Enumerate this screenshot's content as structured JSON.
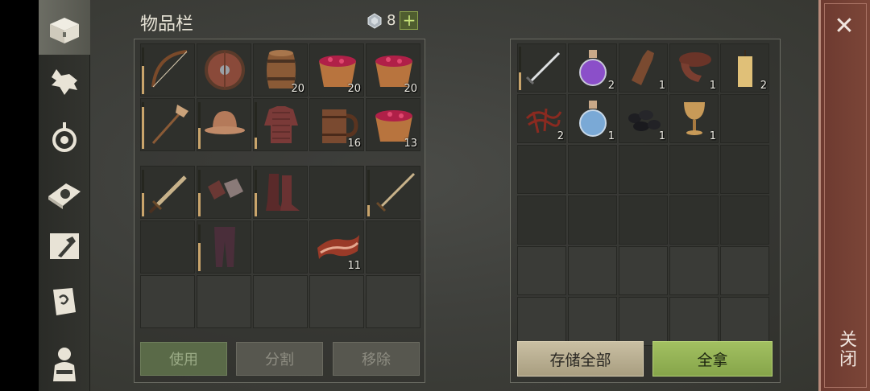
{
  "inventory": {
    "title": "物品栏",
    "currency": {
      "icon": "gem-icon",
      "count": "8",
      "add_label": "+"
    },
    "top_grid": [
      {
        "name": "bow",
        "icon": "bow-icon",
        "qty": "",
        "durability": 0.6
      },
      {
        "name": "round-shield",
        "icon": "shield-icon",
        "qty": ""
      },
      {
        "name": "barrel",
        "icon": "barrel-icon",
        "qty": "20"
      },
      {
        "name": "berry-bowl",
        "icon": "berry-bowl-icon",
        "qty": "20"
      },
      {
        "name": "berry-bowl",
        "icon": "berry-bowl-icon",
        "qty": "20"
      },
      {
        "name": "shovel",
        "icon": "shovel-icon",
        "qty": "",
        "durability": 0.9
      },
      {
        "name": "helmet",
        "icon": "helmet-icon",
        "qty": "",
        "durability": 0.45
      },
      {
        "name": "chainmail",
        "icon": "chainmail-icon",
        "qty": "",
        "durability": 0.25
      },
      {
        "name": "mug",
        "icon": "mug-icon",
        "qty": "16"
      },
      {
        "name": "berry-bowl",
        "icon": "berry-bowl-icon",
        "qty": "13"
      }
    ],
    "bottom_grid": [
      {
        "name": "sword",
        "icon": "sword-icon",
        "qty": "",
        "durability": 0.5
      },
      {
        "name": "gloves",
        "icon": "gloves-icon",
        "qty": "",
        "durability": 0.5
      },
      {
        "name": "boots",
        "icon": "boots-icon",
        "qty": "",
        "durability": 0.5
      },
      {
        "name": "",
        "icon": "",
        "qty": ""
      },
      {
        "name": "long-sword",
        "icon": "longsword-icon",
        "qty": "",
        "durability": 0.25
      },
      {
        "name": "",
        "icon": "",
        "qty": ""
      },
      {
        "name": "pants",
        "icon": "pants-icon",
        "qty": "",
        "durability": 0.6
      },
      {
        "name": "",
        "icon": "",
        "qty": ""
      },
      {
        "name": "bacon",
        "icon": "bacon-icon",
        "qty": "11"
      },
      {
        "name": "",
        "icon": "",
        "qty": ""
      }
    ],
    "buttons": {
      "use": "使用",
      "split": "分割",
      "remove": "移除"
    }
  },
  "storage": {
    "slots": [
      {
        "name": "sword",
        "icon": "sword-icon",
        "qty": "",
        "durability": 0.4
      },
      {
        "name": "purple-potion",
        "icon": "potion-icon",
        "qty": "2",
        "color": "#8b4fc9"
      },
      {
        "name": "bottle",
        "icon": "bottle-icon",
        "qty": "1"
      },
      {
        "name": "leather",
        "icon": "leather-icon",
        "qty": "1"
      },
      {
        "name": "candle",
        "icon": "candle-icon",
        "qty": "2"
      },
      {
        "name": "fibers",
        "icon": "fiber-icon",
        "qty": "2"
      },
      {
        "name": "water-potion",
        "icon": "potion-icon",
        "qty": "1",
        "color": "#7aa9d6"
      },
      {
        "name": "coal",
        "icon": "coal-icon",
        "qty": "1"
      },
      {
        "name": "goblet",
        "icon": "goblet-icon",
        "qty": "1"
      }
    ],
    "buttons": {
      "store_all": "存储全部",
      "take_all": "全拿"
    }
  },
  "close": {
    "icon": "close-icon",
    "label": "关闭"
  },
  "sidebar": [
    {
      "name": "chest",
      "icon": "chest-icon",
      "active": true
    },
    {
      "name": "wolf",
      "icon": "wolf-icon"
    },
    {
      "name": "target",
      "icon": "target-icon"
    },
    {
      "name": "skills-book",
      "icon": "sun-book-icon"
    },
    {
      "name": "craft",
      "icon": "hammer-icon"
    },
    {
      "name": "quests",
      "icon": "scroll-icon"
    },
    {
      "name": "character",
      "icon": "character-icon"
    }
  ],
  "colors": {
    "accent_green": "#9ab85a",
    "durability": "#c9a46b",
    "close_bg": "#7c4638"
  }
}
